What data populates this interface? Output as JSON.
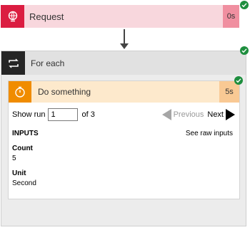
{
  "request": {
    "title": "Request",
    "duration": "0s",
    "icon": "globe-icon"
  },
  "foreach": {
    "title": "For each",
    "icon": "loop-icon"
  },
  "action": {
    "title": "Do something",
    "duration": "5s",
    "icon": "timer-icon",
    "show_run_label": "Show run",
    "run_value": "1",
    "of_label": "of 3",
    "previous_label": "Previous",
    "next_label": "Next",
    "inputs_heading": "INPUTS",
    "raw_inputs_link": "See raw inputs",
    "fields": [
      {
        "name": "Count",
        "value": "5"
      },
      {
        "name": "Unit",
        "value": "Second"
      }
    ]
  },
  "colors": {
    "request_accent": "#db1d41",
    "foreach_accent": "#262626",
    "action_accent": "#f08c00",
    "success": "#1e8e3e"
  }
}
